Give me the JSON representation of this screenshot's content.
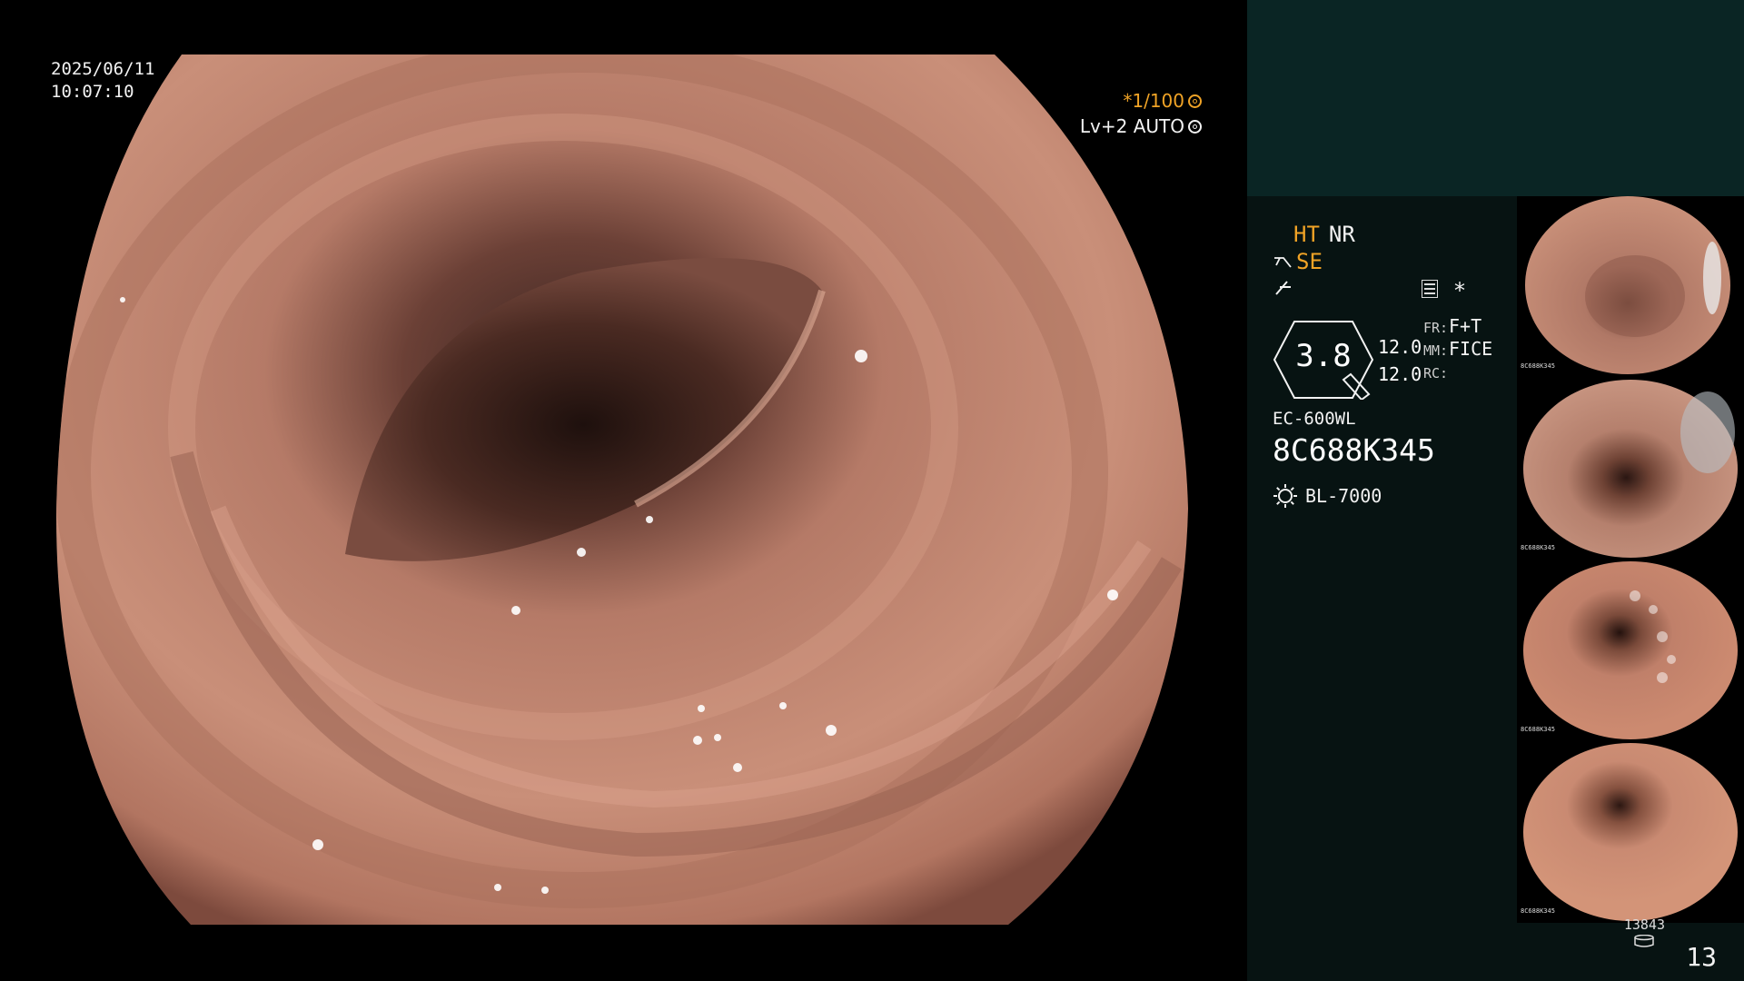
{
  "main_view": {
    "date": "2025/06/11",
    "time": "10:07:10",
    "shutter": "*1/100",
    "level": "Lv+2 AUTO"
  },
  "status": {
    "ht": "HT",
    "nr": "NR",
    "se": "SE",
    "enhancement_value": "3.8",
    "num1": "12.0",
    "num2": "12.0",
    "fr_label": "FR:",
    "fr_value": "F+T",
    "mm_label": "MM:",
    "mm_value": "FICE",
    "rc_label": "RC:",
    "scope_model": "EC-600WL",
    "scope_serial": "8C688K345",
    "light_source": "BL-7000",
    "star": "*"
  },
  "footer": {
    "image_count": "13843",
    "page_number": "13"
  },
  "colors": {
    "accent_orange": "#f0a326",
    "panel_bg": "#071312",
    "top_block": "#0a2524"
  },
  "icons": [
    "shutter-gear-icon",
    "auto-ring-icon",
    "se-enhance-icon",
    "structure-icon",
    "list-icon",
    "light-bulb-icon",
    "database-icon"
  ]
}
